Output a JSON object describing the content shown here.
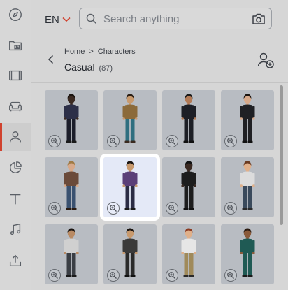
{
  "sidebar": {
    "items": [
      {
        "name": "compass-icon",
        "active": false
      },
      {
        "name": "media-folder-icon",
        "active": false
      },
      {
        "name": "film-icon",
        "active": false
      },
      {
        "name": "sofa-icon",
        "active": false
      },
      {
        "name": "user-icon",
        "active": true
      },
      {
        "name": "pie-chart-icon",
        "active": false
      },
      {
        "name": "text-icon",
        "active": false
      },
      {
        "name": "music-icon",
        "active": false
      },
      {
        "name": "upload-icon",
        "active": false
      }
    ],
    "accent_color": "#d0422e"
  },
  "header": {
    "language": "EN",
    "search_placeholder": "Search anything"
  },
  "breadcrumb": {
    "home": "Home",
    "section": "Characters"
  },
  "page": {
    "title": "Casual",
    "count": "(87)"
  },
  "characters": [
    {
      "skin": "#3b2a22",
      "hair": "#1a1410",
      "top": "#2c2f48",
      "pants": "#1b1d2a",
      "shoes": "#1a1a1a"
    },
    {
      "skin": "#c89a6e",
      "hair": "#2a1e14",
      "top": "#8b6a3a",
      "pants": "#2f6f80",
      "shoes": "#3a2a20"
    },
    {
      "skin": "#b27a56",
      "hair": "#1a1a1a",
      "top": "#1d1f26",
      "pants": "#1d1f26",
      "shoes": "#111111"
    },
    {
      "skin": "#d7a98a",
      "hair": "#1a1410",
      "top": "#1f2024",
      "pants": "#1f2024",
      "shoes": "#111111"
    },
    {
      "skin": "#d7a98a",
      "hair": "#a07a44",
      "top": "#6a4a3a",
      "pants": "#3a5170",
      "shoes": "#2a1a10"
    },
    {
      "skin": "#c89a6e",
      "hair": "#1a1410",
      "top": "#5a3f78",
      "pants": "#2b2c44",
      "shoes": "#1a1a1a"
    },
    {
      "skin": "#3b2a22",
      "hair": "#111111",
      "top": "#1d1d1d",
      "pants": "#1d1d1d",
      "shoes": "#111111"
    },
    {
      "skin": "#e0b08a",
      "hair": "#6a3a20",
      "top": "#dcdcdc",
      "pants": "#3a4a5c",
      "shoes": "#2a2a2a"
    },
    {
      "skin": "#b88a64",
      "hair": "#1a1410",
      "top": "#d0d0d0",
      "pants": "#3a3e44",
      "shoes": "#1a1a1a"
    },
    {
      "skin": "#c89a6e",
      "hair": "#1a1410",
      "top": "#3a3a3a",
      "pants": "#2a2a2a",
      "shoes": "#111111"
    },
    {
      "skin": "#e0b08a",
      "hair": "#8a3a20",
      "top": "#e6e6e6",
      "pants": "#a08a5a",
      "shoes": "#2a2a2a"
    },
    {
      "skin": "#8a5a3a",
      "hair": "#2a1a10",
      "top": "#1f5a54",
      "pants": "#1f5a54",
      "shoes": "#1a1a1a"
    }
  ],
  "selected_index": 5
}
